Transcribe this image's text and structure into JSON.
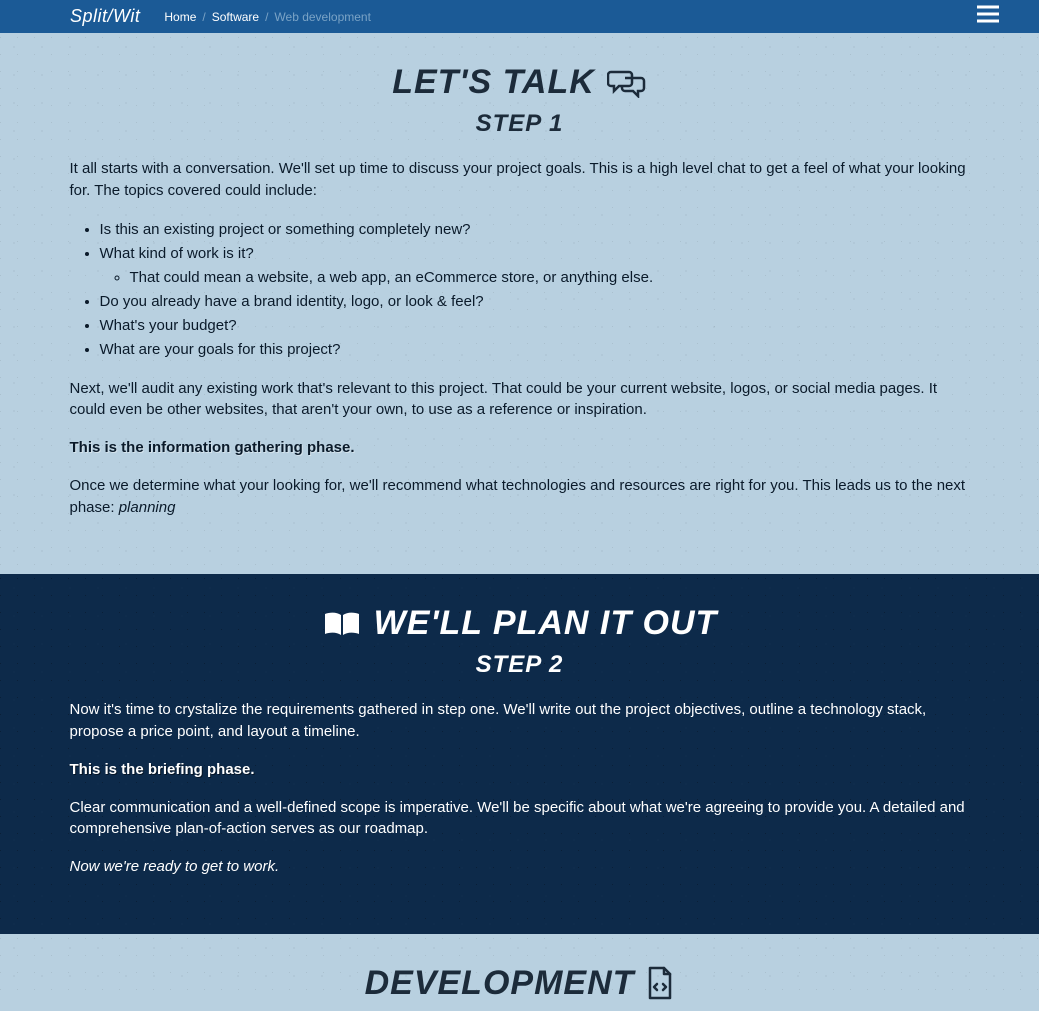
{
  "nav": {
    "logo": "Split/Wit",
    "breadcrumb": {
      "home": "Home",
      "software": "Software",
      "current": "Web development"
    }
  },
  "step1": {
    "title": "LET'S TALK",
    "step": "STEP 1",
    "intro": "It all starts with a conversation. We'll set up time to discuss your project goals. This is a high level chat to get a feel of what your looking for. The topics covered could include:",
    "bullets": {
      "b1": "Is this an existing project or something completely new?",
      "b2": "What kind of work is it?",
      "b2a": "That could mean a website, a web app, an eCommerce store, or anything else.",
      "b3": "Do you already have a brand identity, logo, or look & feel?",
      "b4": "What's your budget?",
      "b5": "What are your goals for this project?"
    },
    "para2": "Next, we'll audit any existing work that's relevant to this project. That could be your current website, logos, or social media pages. It could even be other websites, that aren't your own, to use as a reference or inspiration.",
    "phase": "This is the information gathering phase.",
    "para3_a": "Once we determine what your looking for, we'll recommend what technologies and resources are right for you. This leads us to the next phase: ",
    "para3_em": "planning"
  },
  "step2": {
    "title": "WE'LL PLAN IT OUT",
    "step": "STEP 2",
    "para1": "Now it's time to crystalize the requirements gathered in step one. We'll write out the project objectives, outline a technology stack, propose a price point, and layout a timeline.",
    "phase": "This is the briefing phase.",
    "para2": "Clear communication and a well-defined scope is imperative. We'll be specific about what we're agreeing to provide you. A detailed and comprehensive plan-of-action serves as our roadmap.",
    "ready": "Now we're ready to get to work."
  },
  "step3": {
    "title": "DEVELOPMENT"
  }
}
